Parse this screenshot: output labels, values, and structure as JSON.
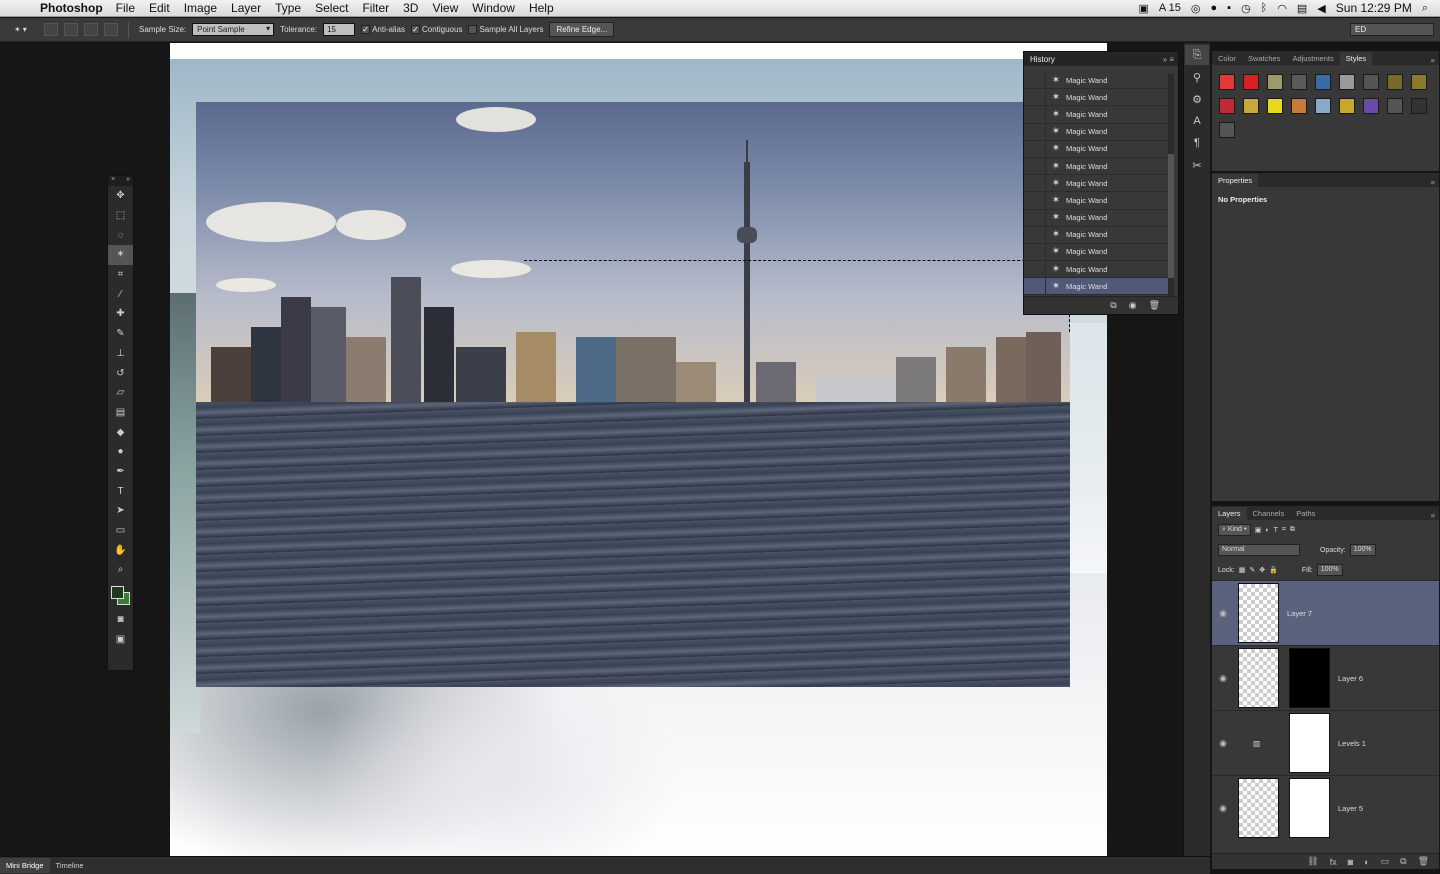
{
  "menubar": {
    "app_name": "Photoshop",
    "menus": [
      "File",
      "Edit",
      "Image",
      "Layer",
      "Type",
      "Select",
      "Filter",
      "3D",
      "View",
      "Window",
      "Help"
    ],
    "status": {
      "adobe_count": "15",
      "clock": "Sun 12:29 PM"
    }
  },
  "options": {
    "sample_size_label": "Sample Size:",
    "sample_size_value": "Point Sample",
    "tolerance_label": "Tolerance:",
    "tolerance_value": "15",
    "anti_alias_label": "Anti-alias",
    "contiguous_label": "Contiguous",
    "sample_all_label": "Sample All Layers",
    "refine_edge_label": "Refine Edge...",
    "workspace_value": "ED"
  },
  "history": {
    "title": "History",
    "items": [
      "Magic Wand",
      "Magic Wand",
      "Magic Wand",
      "Magic Wand",
      "Magic Wand",
      "Magic Wand",
      "Magic Wand",
      "Magic Wand",
      "Magic Wand",
      "Magic Wand",
      "Magic Wand",
      "Magic Wand",
      "Magic Wand"
    ],
    "active_index": 12
  },
  "styles_panel": {
    "tabs": [
      "Color",
      "Swatches",
      "Adjustments",
      "Styles"
    ],
    "active_tab": "Styles",
    "swatch_colors": [
      "#e23a3a",
      "#d62222",
      "#9a9a6a",
      "#5a5a5a",
      "#3a6aa8",
      "#9a9a9a",
      "#555555",
      "#7a6a2a",
      "#8a7a2a",
      "#c22a3a",
      "#c8a83a",
      "#e8d820",
      "#c87a3a",
      "#8aa8c8",
      "#c8a82a",
      "#6a4aa8",
      "#555555",
      "#333333",
      "#555555"
    ]
  },
  "properties_panel": {
    "title": "Properties",
    "body": "No Properties"
  },
  "layers_panel": {
    "tabs": [
      "Layers",
      "Channels",
      "Paths"
    ],
    "kind_label": "Kind",
    "blend_mode": "Normal",
    "opacity_label": "Opacity:",
    "opacity_value": "100%",
    "lock_label": "Lock:",
    "fill_label": "Fill:",
    "fill_value": "100%",
    "layers": [
      {
        "name": "Layer 7"
      },
      {
        "name": "Layer 6"
      },
      {
        "name": "Levels 1"
      },
      {
        "name": "Layer 5"
      }
    ]
  },
  "bottombar": {
    "tabs": [
      "Mini Bridge",
      "Timeline"
    ]
  }
}
